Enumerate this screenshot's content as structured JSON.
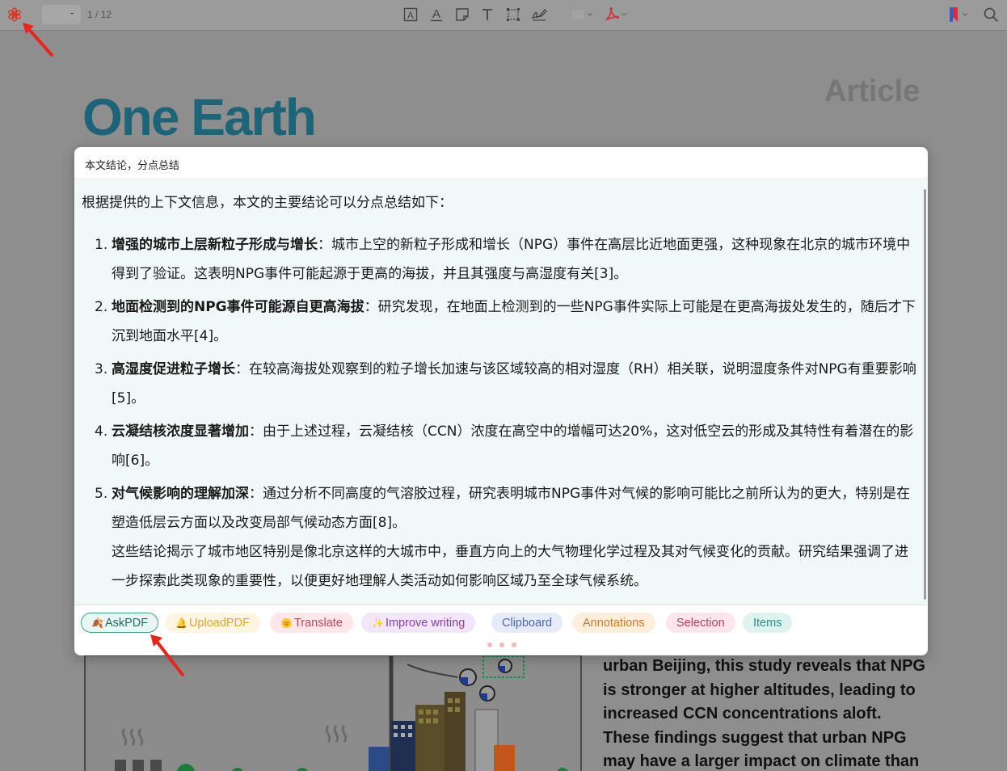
{
  "toolbar": {
    "page_input_value": "-",
    "page_count": "1 / 12",
    "icons": [
      "openai-logo-icon",
      "text-box-icon",
      "text-underline-icon",
      "callout-icon",
      "text-icon",
      "crop-icon",
      "signature-icon",
      "blank-shape-icon",
      "adobe-pdf-icon",
      "bookmark-icon",
      "search-icon"
    ],
    "colors": {
      "logo": "#e2301f",
      "bookmark": "#d2303a",
      "pdf": "#d2303a"
    }
  },
  "document": {
    "article_label": "Article",
    "journal_title": "One Earth",
    "abstract_lines": [
      "urban Beijing, this study reveals that NPG",
      "is stronger at higher altitudes, leading to",
      "increased CCN concentrations aloft.",
      "These findings suggest that urban NPG",
      "may have a larger impact on climate than"
    ]
  },
  "dialog": {
    "query": "本文结论，分点总结",
    "intro": "根据提供的上下文信息，本文的主要结论可以分点总结如下：",
    "items": [
      {
        "num": "1.",
        "title": "增强的城市上层新粒子形成与增长",
        "body": "：城市上空的新粒子形成和增长（NPG）事件在高层比近地面更强，这种现象在北京的城市环境中得到了验证。这表明NPG事件可能起源于更高的海拔，并且其强度与高湿度有关[3]。"
      },
      {
        "num": "2.",
        "title": "地面检测到的NPG事件可能源自更高海拔",
        "body": "：研究发现，在地面上检测到的一些NPG事件实际上可能是在更高海拔处发生的，随后才下沉到地面水平[4]。"
      },
      {
        "num": "3.",
        "title": "高湿度促进粒子增长",
        "body": "：在较高海拔处观察到的粒子增长加速与该区域较高的相对湿度（RH）相关联，说明湿度条件对NPG有重要影响[5]。"
      },
      {
        "num": "4.",
        "title": "云凝结核浓度显著增加",
        "body": "：由于上述过程，云凝结核（CCN）浓度在高空中的增幅可达20%，这对低空云的形成及其特性有着潜在的影响[6]。"
      },
      {
        "num": "5.",
        "title": "对气候影响的理解加深",
        "body": "：通过分析不同高度的气溶胶过程，研究表明城市NPG事件对气候的影响可能比之前所认为的更大，特别是在塑造低层云方面以及改变局部气候动态方面[8]。"
      }
    ],
    "conclusion": "这些结论揭示了城市地区特别是像北京这样的大城市中，垂直方向上的大气物理化学过程及其对气候变化的贡献。研究结果强调了进一步探索此类现象的重要性，以便更好地理解人类活动如何影响区域乃至全球气候系统。",
    "chips": [
      {
        "label": "AskPDF",
        "icon": "🍂",
        "fg": "#1f6e66",
        "bg": "#e9f7f4",
        "border": "#3aa58f"
      },
      {
        "label": "UploadPDF",
        "icon": "🔔",
        "fg": "#e0a335",
        "bg": "#fff6e2",
        "border": "#fff6e2"
      },
      {
        "label": "Translate",
        "icon": "🌞",
        "fg": "#c0445a",
        "bg": "#fde7ea",
        "border": "#fde7ea"
      },
      {
        "label": "Improve writing",
        "icon": "✨",
        "fg": "#8a3db0",
        "bg": "#f2e6fb",
        "border": "#f2e6fb"
      },
      {
        "label": "Clipboard",
        "icon": "",
        "fg": "#4e63b5",
        "bg": "#e6ebfa",
        "border": "#e6ebfa"
      },
      {
        "label": "Annotations",
        "icon": "",
        "fg": "#d07a22",
        "bg": "#fdeedd",
        "border": "#fdeedd"
      },
      {
        "label": "Selection",
        "icon": "",
        "fg": "#c23a5c",
        "bg": "#fce6ec",
        "border": "#fce6ec"
      },
      {
        "label": "Items",
        "icon": "",
        "fg": "#2a8c7e",
        "bg": "#def3ef",
        "border": "#def3ef"
      }
    ]
  },
  "annotation_color": "#e8251d"
}
